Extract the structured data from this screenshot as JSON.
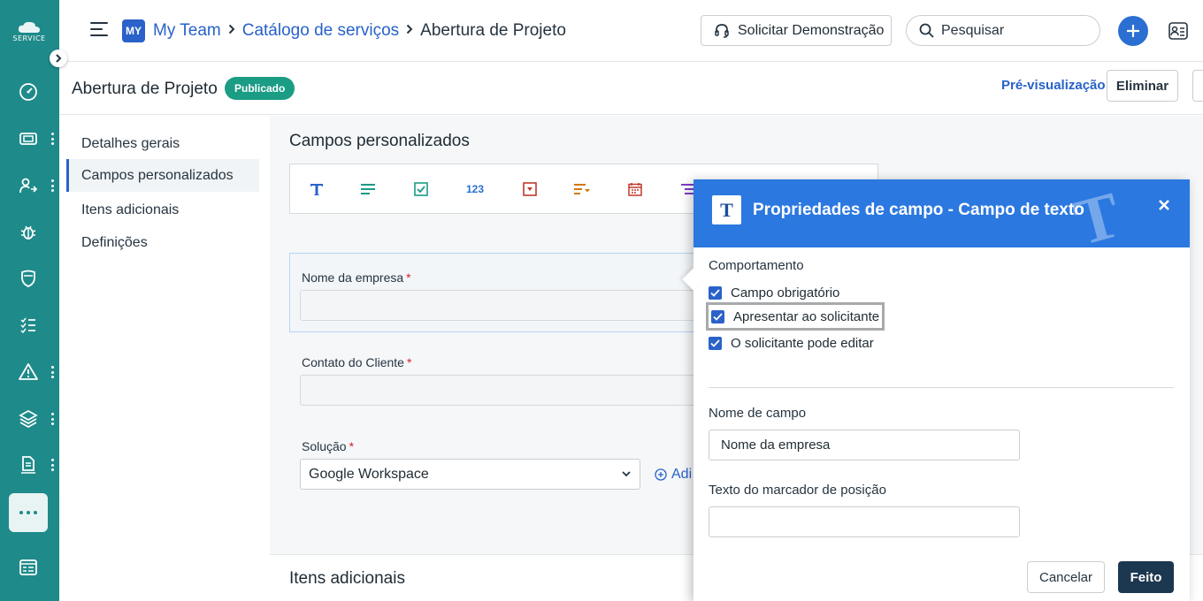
{
  "app": {
    "logo_text": "SERVICE"
  },
  "header": {
    "workspace_icon": "MY",
    "breadcrumb": [
      "My Team",
      "Catálogo de serviços",
      "Abertura de Projeto"
    ],
    "demo_button": "Solicitar Demonstração",
    "search_placeholder": "Pesquisar"
  },
  "rail_icons": [
    "dashboard-icon",
    "tickets-icon",
    "changes-icon",
    "problems-icon",
    "releases-icon",
    "tasks-icon",
    "alerts-icon",
    "assets-icon",
    "reports-icon",
    "more-icon",
    "solutions-icon"
  ],
  "page": {
    "title": "Abertura de Projeto",
    "status": "Publicado",
    "preview_link": "Pré-visualização",
    "delete_button": "Eliminar"
  },
  "tabs": [
    "Detalhes gerais",
    "Campos personalizados",
    "Itens adicionais",
    "Definições"
  ],
  "active_tab": "Campos personalizados",
  "custom_fields": {
    "section_title": "Campos personalizados",
    "toolbar": [
      "text-field-icon",
      "paragraph-icon",
      "checkbox-icon",
      "number-icon",
      "dropdown-icon",
      "multiselect-icon",
      "date-icon",
      "list-icon"
    ],
    "number_label": "123",
    "fields": [
      {
        "label": "Nome da empresa",
        "required": "*"
      },
      {
        "label": "Contato do Cliente",
        "required": "*"
      },
      {
        "label": "Solução",
        "required": "*",
        "value": "Google Workspace"
      }
    ],
    "add_link": "Adi",
    "next_section": "Itens adicionais"
  },
  "panel": {
    "title": "Propriedades de campo - Campo de texto",
    "icon_letter": "T",
    "behaviour_label": "Comportamento",
    "checkboxes": [
      {
        "label": "Campo obrigatório",
        "checked": true
      },
      {
        "label": "Apresentar ao solicitante",
        "checked": true
      },
      {
        "label": "O solicitante pode editar",
        "checked": true
      }
    ],
    "field_name_label": "Nome de campo",
    "field_name_value": "Nome da empresa",
    "placeholder_label": "Texto do marcador de posição",
    "placeholder_value": "",
    "cancel_button": "Cancelar",
    "done_button": "Feito"
  },
  "colors": {
    "rail": "#1f8a8a",
    "primary": "#2b78e0",
    "link": "#2762c8",
    "badge": "#1b9c85",
    "done": "#1c3750"
  }
}
